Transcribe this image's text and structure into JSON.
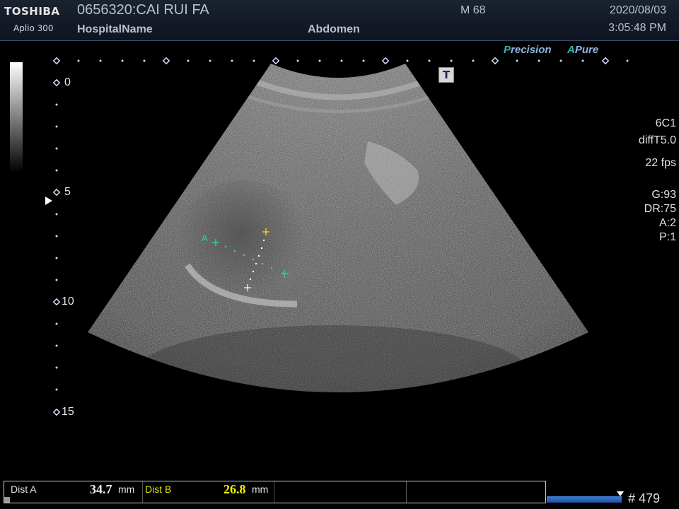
{
  "header": {
    "brand": "TOSHIBA",
    "model": "Aplio 300",
    "patient_id_name": "0656320:CAI RUI FA",
    "hospital": "HospitalName",
    "exam": "Abdomen",
    "mi": "M 68",
    "date": "2020/08/03",
    "time": "3:05:48 PM"
  },
  "logos": {
    "precision_initial": "P",
    "precision_rest": "recision",
    "apure_initial": "A",
    "apure_rest": "Pure"
  },
  "depth_scale": {
    "labels": [
      "0",
      "5",
      "10",
      "15"
    ],
    "max_depth": 15
  },
  "params": {
    "probe": "6C1",
    "mode": "diffT5.0",
    "fps": "22 fps",
    "gain": "G:93",
    "dynamic_range": "DR:75",
    "a": "A:2",
    "p": "P:1"
  },
  "t_button": "T",
  "measurements": [
    {
      "name": "Dist A",
      "value": "34.7",
      "unit": "mm",
      "color": "#e0e0e0",
      "label_color": "#e0e0e0"
    },
    {
      "name": "Dist B",
      "value": "26.8",
      "unit": "mm",
      "color": "#f0f000",
      "label_color": "#e0e000"
    }
  ],
  "caliper_label": "A",
  "cine": {
    "frame": "# 479"
  },
  "colors": {
    "caliper_a": "#2fd0a0",
    "caliper_b": "#e8d020",
    "accent": "#8fb4e0"
  }
}
